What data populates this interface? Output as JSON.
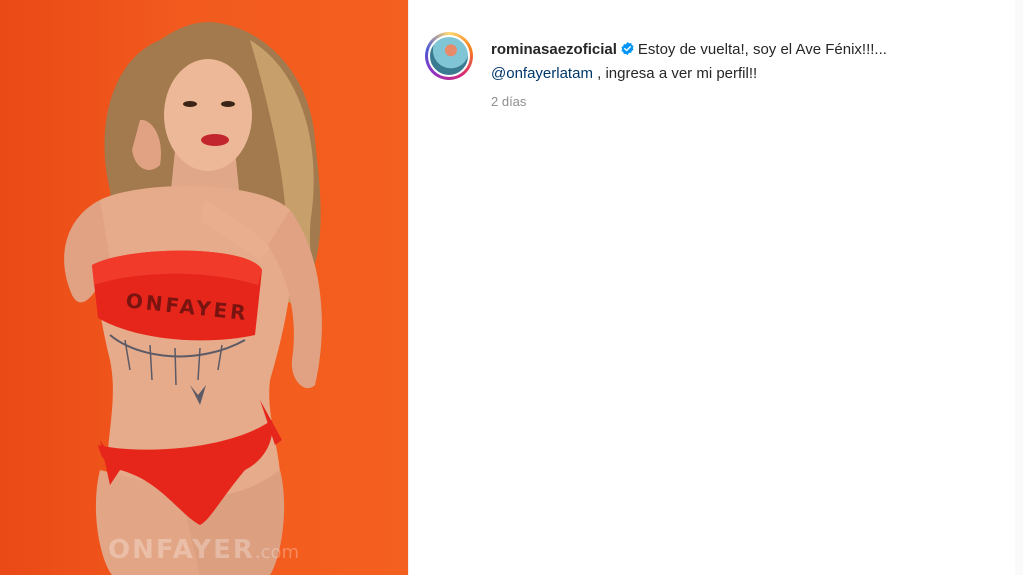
{
  "post": {
    "media": {
      "description_icon": "photo",
      "background_color": "#f25a1e",
      "watermark_brand": "ONFAYER",
      "watermark_suffix": ".com",
      "bikini_text": "ONFAYER"
    },
    "caption": {
      "username": "rominasaezoficial",
      "verified_icon": "verified-badge-icon",
      "text_line1": "Estoy de vuelta!, soy el Ave Fénix!!!...",
      "mention": "@onfayerlatam",
      "text_line2": " , ingresa a ver mi perfil!!",
      "timestamp": "2 días"
    },
    "colors": {
      "verified": "#0095f6",
      "mention": "#00376b",
      "muted": "#8e8e8e"
    }
  }
}
